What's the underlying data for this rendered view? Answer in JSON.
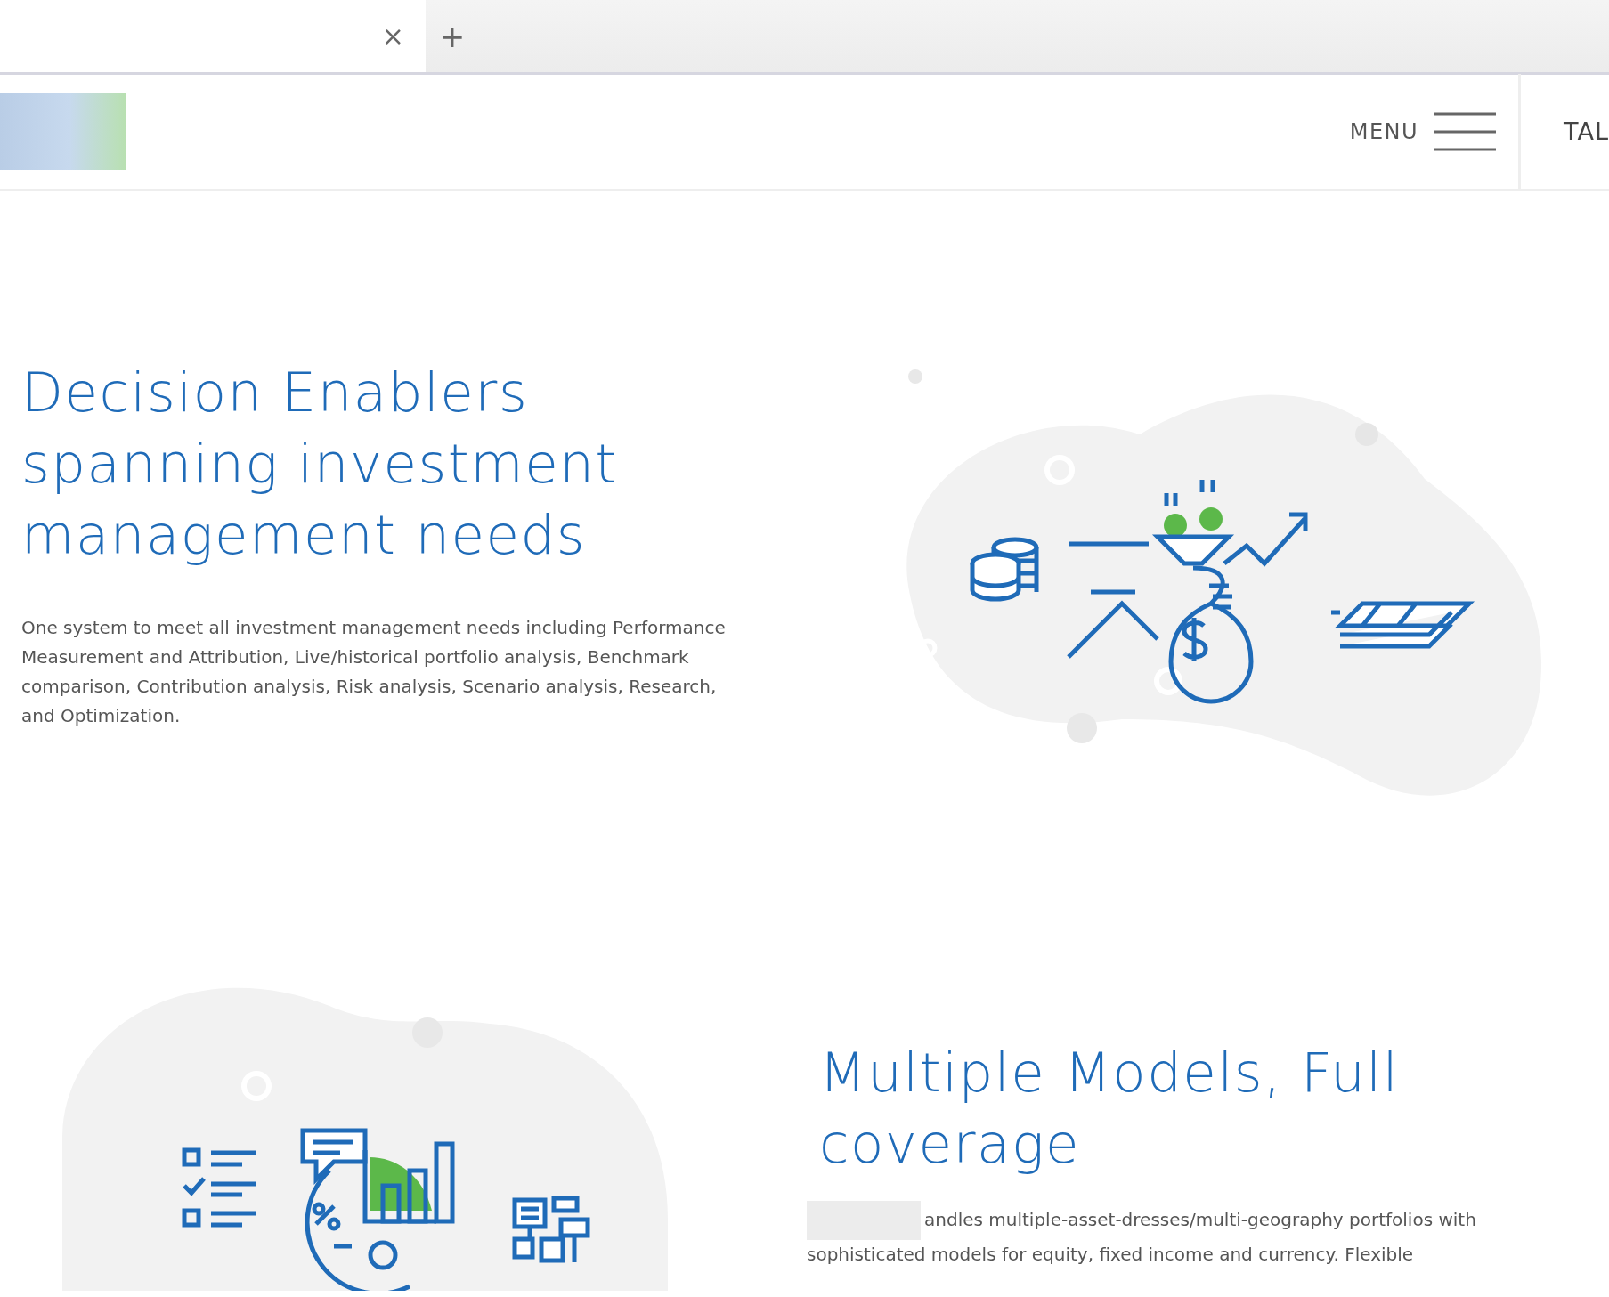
{
  "browser": {
    "tab": {
      "close_glyph": "×"
    },
    "new_tab_glyph": "+"
  },
  "header": {
    "menu_label": "MENU",
    "cut_link": "TAL"
  },
  "sections": [
    {
      "kind": "text-first",
      "illustration": {
        "kind": "finance"
      },
      "heading": "Decision Enablers spanning investment management needs",
      "body": "One system to meet all investment management needs including Performance Measurement and Attribution, Live/historical portfolio analysis, Benchmark comparison, Contribution analysis, Risk analysis, Scenario analysis, Research, and Optimization."
    },
    {
      "kind": "image-first",
      "illustration": {
        "kind": "analytics"
      },
      "heading": "Multiple Models, Full coverage",
      "body": "andles multiple-asset-dresses/multi-geography portfolios with sophisticated models for equity, fixed income and currency. Flexible"
    }
  ]
}
